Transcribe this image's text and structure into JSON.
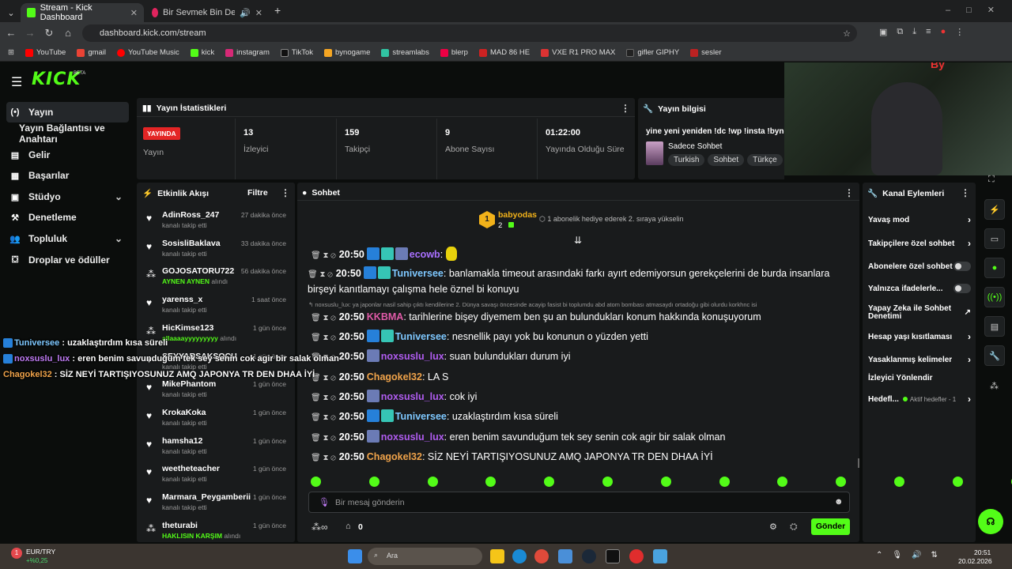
{
  "browser": {
    "tabs": [
      {
        "title": "Stream - Kick Dashboard",
        "active": true
      },
      {
        "title": "Bir Sevmek Bin Defa Ölmek",
        "active": false
      }
    ],
    "url": "dashboard.kick.com/stream",
    "bookmarks": [
      "YouTube",
      "gmail",
      "YouTube Music",
      "kick",
      "instagram",
      "TikTok",
      "bynogame",
      "streamlabs",
      "blerp",
      "MAD 86 HE",
      "VXE R1 PRO MAX",
      "gifler GIPHY",
      "sesler"
    ]
  },
  "header": {
    "logo": "KICK",
    "beta": "BETA"
  },
  "sidebar": {
    "items": [
      {
        "label": "Yayın",
        "icon": "broadcast-icon"
      },
      {
        "label": "Yayın Bağlantısı ve Anahtarı",
        "icon": ""
      },
      {
        "label": "Gelir",
        "icon": "revenue-icon"
      },
      {
        "label": "Başarılar",
        "icon": "achievements-icon"
      },
      {
        "label": "Stüdyo",
        "icon": "studio-icon"
      },
      {
        "label": "Denetleme",
        "icon": "moderation-icon"
      },
      {
        "label": "Topluluk",
        "icon": "community-icon"
      },
      {
        "label": "Droplar ve ödüller",
        "icon": "drops-icon"
      }
    ]
  },
  "stats": {
    "title": "Yayın İstatistikleri",
    "live_badge": "YAYINDA",
    "live_label": "Yayın",
    "items": [
      {
        "value": "13",
        "label": "İzleyici"
      },
      {
        "value": "159",
        "label": "Takipçi"
      },
      {
        "value": "9",
        "label": "Abone Sayısı"
      },
      {
        "value": "01:22:00",
        "label": "Yayında Olduğu Süre"
      }
    ]
  },
  "stream_info": {
    "title": "Yayın bilgisi",
    "stream_title": "yine yeni yeniden !dc !wp !insta !bynog",
    "category": "Sadece Sohbet",
    "tags": [
      "Turkish",
      "Sohbet",
      "Türkçe"
    ]
  },
  "activity": {
    "title": "Etkinlik Akışı",
    "filter": "Filtre",
    "events": [
      {
        "name": "AdinRoss_247",
        "detail": "kanalı takip etti",
        "highlight": "",
        "time": "27 dakika önce",
        "icon": "heart"
      },
      {
        "name": "SosisliBaklava",
        "detail": "kanalı takip etti",
        "highlight": "",
        "time": "33 dakika önce",
        "icon": "heart"
      },
      {
        "name": "GOJOSATORU722",
        "detail": "alındı",
        "highlight": "AYNEN AYNEN",
        "time": "56 dakika önce",
        "icon": "reward"
      },
      {
        "name": "yarenss_x",
        "detail": "kanalı takip etti",
        "highlight": "",
        "time": "1 saat önce",
        "icon": "heart"
      },
      {
        "name": "HicKimse123",
        "detail": "alındı",
        "highlight": "allaaaayyyyyyyyy",
        "time": "1 gün önce",
        "icon": "reward"
      },
      {
        "name": "SEYYARSAKSOCU",
        "detail": "kanalı takip etti",
        "highlight": "",
        "time": "1 gün önce",
        "icon": "heart"
      },
      {
        "name": "MikePhantom",
        "detail": "kanalı takip etti",
        "highlight": "",
        "time": "1 gün önce",
        "icon": "heart"
      },
      {
        "name": "KrokaKoka",
        "detail": "kanalı takip etti",
        "highlight": "",
        "time": "1 gün önce",
        "icon": "heart"
      },
      {
        "name": "hamsha12",
        "detail": "kanalı takip etti",
        "highlight": "",
        "time": "1 gün önce",
        "icon": "heart"
      },
      {
        "name": "weetheteacher",
        "detail": "kanalı takip etti",
        "highlight": "",
        "time": "1 gün önce",
        "icon": "heart"
      },
      {
        "name": "Marmara_Peygamberii",
        "detail": "kanalı takip etti",
        "highlight": "",
        "time": "1 gün önce",
        "icon": "heart"
      },
      {
        "name": "theturabi",
        "detail": "alındı",
        "highlight": "HAKLISIN KARŞIM",
        "time": "1 gün önce",
        "icon": "reward"
      }
    ]
  },
  "chat": {
    "title": "Sohbet",
    "pinned_user": "babyodas",
    "pinned_rank": "1",
    "pinned_count": "2",
    "pinned_text": "1 abonelik hediye ederek 2. sıraya yükselin",
    "reply_context": "noxsuslu_lux: ya japonlar nasil sahip çıktı kendilerine 2. Dünya savaşı öncesinde acayip fasist bi toplumdu abd atom bombası atmasaydı ortadoğu gibi olurdu korkhnc isi",
    "messages": [
      {
        "time": "20:50",
        "user": "ecowb",
        "color": "#a970ff",
        "text": "",
        "badges": [
          "b1",
          "b2",
          "b3"
        ]
      },
      {
        "time": "20:50",
        "user": "Tuniversee",
        "color": "#7ec8ff",
        "text": "banlamakla timeout arasındaki farkı ayırt edemiyorsun gerekçelerini de burda insanlara birşeyi kanıtlamayı çalışma hele öznel bi konuyu",
        "badges": [
          "b1",
          "b2"
        ]
      },
      {
        "time": "20:50",
        "user": "KKBMA",
        "color": "#e05aa8",
        "text": "tarihlerine bişey diyemem ben şu an bulundukları konum hakkında konuşuyorum",
        "badges": []
      },
      {
        "time": "20:50",
        "user": "Tuniversee",
        "color": "#7ec8ff",
        "text": "nesnellik payı yok bu konunun o yüzden yetti",
        "badges": [
          "b1",
          "b2"
        ]
      },
      {
        "time": "20:50",
        "user": "noxsuslu_lux",
        "color": "#b05cf0",
        "text": "suan bulundukları durum iyi",
        "badges": [
          "b3"
        ]
      },
      {
        "time": "20:50",
        "user": "Chagokel32",
        "color": "#f0a34a",
        "text": "LA S",
        "badges": []
      },
      {
        "time": "20:50",
        "user": "noxsuslu_lux",
        "color": "#b05cf0",
        "text": "cok iyi",
        "badges": [
          "b3"
        ]
      },
      {
        "time": "20:50",
        "user": "Tuniversee",
        "color": "#7ec8ff",
        "text": "uzaklaştırdım kısa süreli",
        "badges": [
          "b1",
          "b2"
        ]
      },
      {
        "time": "20:50",
        "user": "noxsuslu_lux",
        "color": "#b05cf0",
        "text": "eren benim savunduğum tek sey senin cok agir bir salak olman",
        "badges": [
          "b3"
        ]
      },
      {
        "time": "20:50",
        "user": "Chagokel32",
        "color": "#f0a34a",
        "text": "SİZ NEYİ TARTIŞIYOSUNUZ AMQ JAPONYA TR DEN DHAA İYİ",
        "badges": []
      }
    ],
    "input_placeholder": "Bir mesaj gönderin",
    "points": "0",
    "send": "Gönder"
  },
  "channel_actions": {
    "title": "Kanal Eylemleri",
    "items": [
      {
        "label": "Yavaş mod",
        "control": "arrow"
      },
      {
        "label": "Takipçilere özel sohbet",
        "control": "arrow"
      },
      {
        "label": "Abonelere özel sohbet",
        "control": "toggle"
      },
      {
        "label": "Yalnızca ifadelerle...",
        "control": "toggle"
      },
      {
        "label": "Yapay Zeka ile Sohbet Denetimi",
        "control": "external"
      },
      {
        "label": "Hesap yaşı kısıtlaması",
        "control": "arrow"
      },
      {
        "label": "Yasaklanmış kelimeler",
        "control": "arrow"
      },
      {
        "label": "İzleyici Yönlendir",
        "control": "none"
      }
    ],
    "goals_label": "Hedefl...",
    "goals_status": "Aktif hedefler - 1"
  },
  "overlay": [
    {
      "user": "Tuniversee",
      "color": "#7ec8ff",
      "text": "uzaklaştırdım kısa süreli"
    },
    {
      "user": "noxsuslu_lux",
      "color": "#c07cf5",
      "text": "eren benim savunduğum tek sey senin cok agir bir salak olman"
    },
    {
      "user": "Chagokel32",
      "color": "#f0a34a",
      "text": "SİZ NEYİ TARTIŞIYOSUNUZ AMQ JAPONYA TR DEN DHAA İYİ"
    }
  ],
  "taskbar": {
    "ticker": "EUR/TRY",
    "ticker_change": "+%0,25",
    "search": "Ara",
    "time": "20:51",
    "date": "20.02.2026"
  }
}
